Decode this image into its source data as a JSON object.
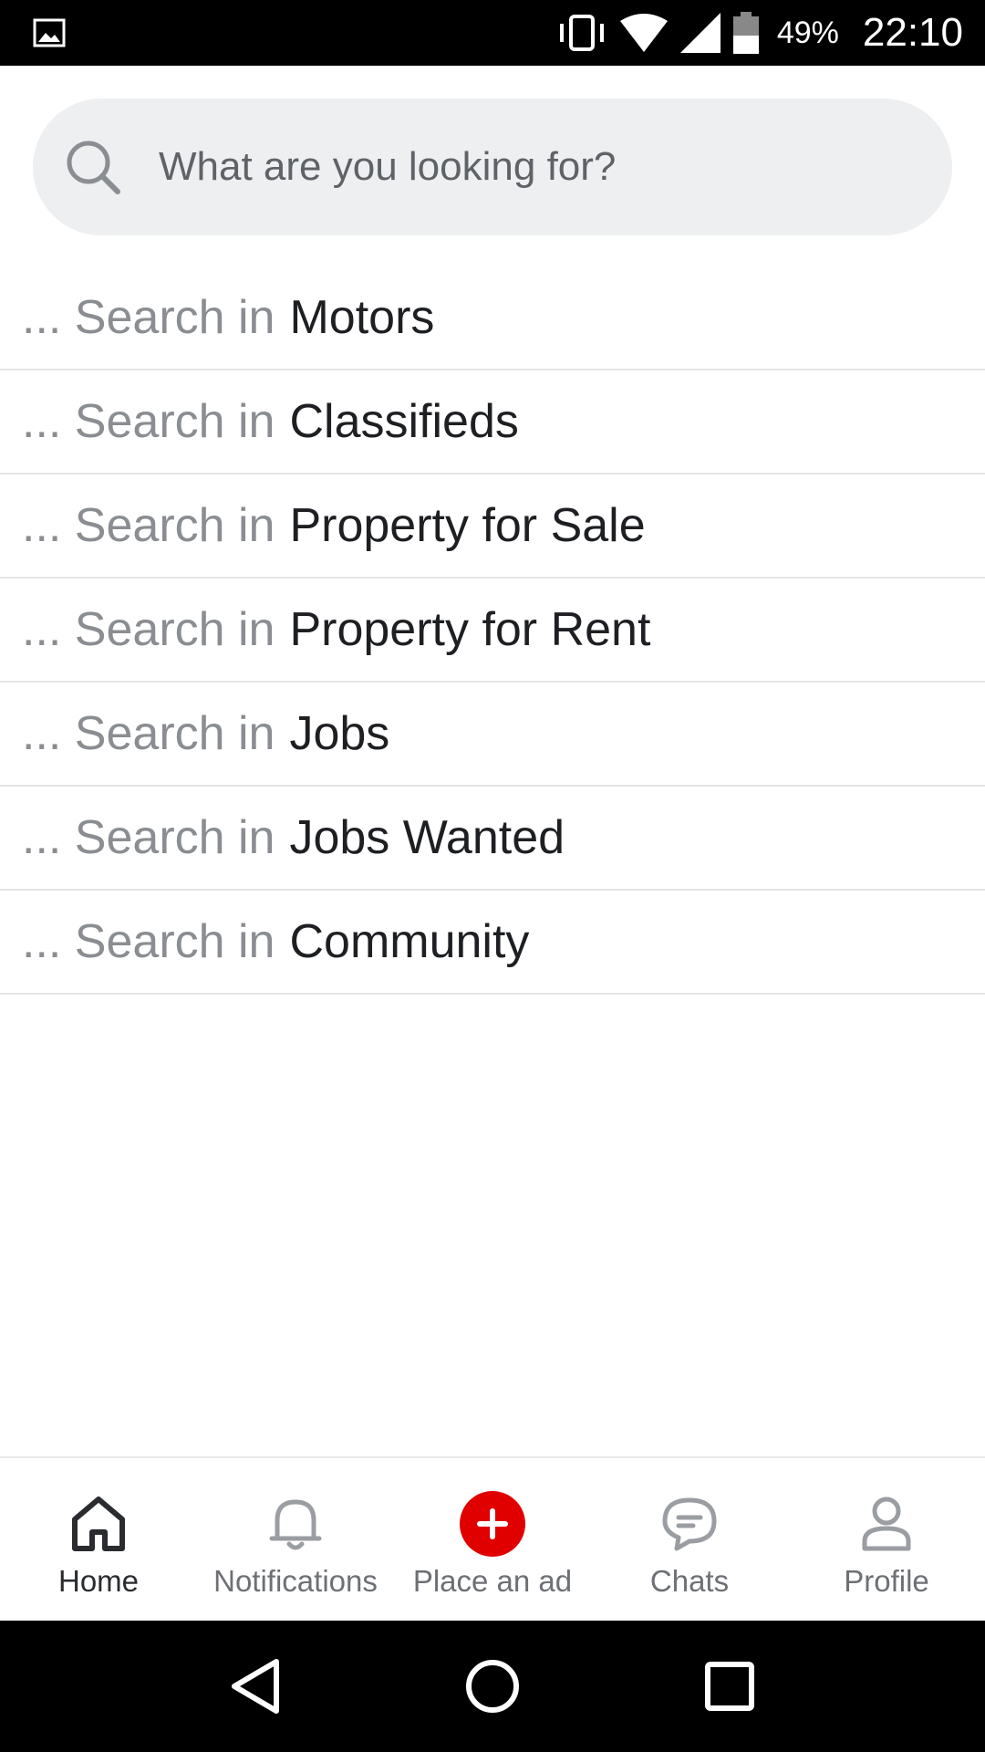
{
  "status_bar": {
    "battery_percent": "49%",
    "time": "22:10",
    "icons": [
      "image-icon",
      "vibrate-icon",
      "wifi-icon",
      "cell-signal-icon",
      "battery-icon"
    ]
  },
  "search": {
    "placeholder": "What are you looking for?",
    "value": ""
  },
  "suggestions": [
    {
      "prefix": "... Search in",
      "category": "Motors"
    },
    {
      "prefix": "... Search in",
      "category": "Classifieds"
    },
    {
      "prefix": "... Search in",
      "category": "Property for Sale"
    },
    {
      "prefix": "... Search in",
      "category": "Property for Rent"
    },
    {
      "prefix": "... Search in",
      "category": "Jobs"
    },
    {
      "prefix": "... Search in",
      "category": "Jobs Wanted"
    },
    {
      "prefix": "... Search in",
      "category": "Community"
    }
  ],
  "bottom_nav": {
    "items": [
      {
        "label": "Home",
        "icon": "home-icon",
        "active": true
      },
      {
        "label": "Notifications",
        "icon": "bell-icon",
        "active": false
      },
      {
        "label": "Place an ad",
        "icon": "plus-circle-icon",
        "active": false
      },
      {
        "label": "Chats",
        "icon": "chat-icon",
        "active": false
      },
      {
        "label": "Profile",
        "icon": "profile-icon",
        "active": false
      }
    ]
  },
  "colors": {
    "accent": "#e00000",
    "search_bg": "#eeeff0",
    "divider": "#e3e4e6",
    "muted_text": "#8a8d91",
    "primary_text": "#1d1f22"
  }
}
